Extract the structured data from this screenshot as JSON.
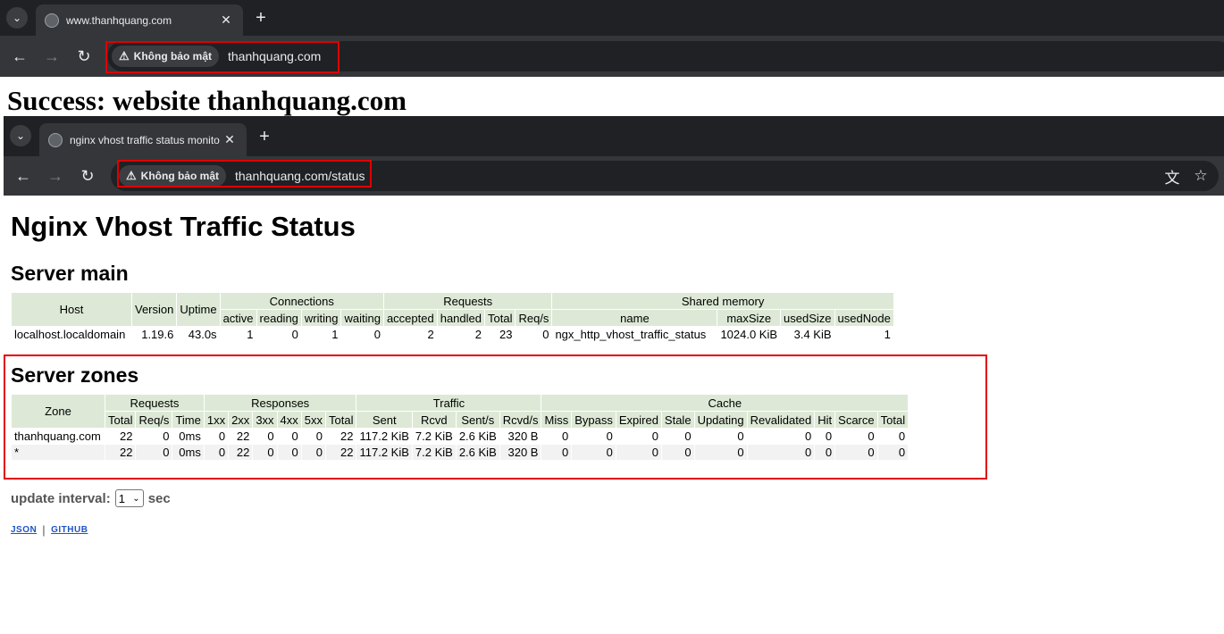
{
  "browser1": {
    "tab_title": "www.thanhquang.com",
    "security_label": "Không bảo mật",
    "url": "thanhquang.com"
  },
  "success_heading": "Success: website thanhquang.com",
  "browser2": {
    "tab_title": "nginx vhost traffic status monito",
    "security_label": "Không bảo mật",
    "url": "thanhquang.com/status"
  },
  "page": {
    "title": "Nginx Vhost Traffic Status",
    "server_main": {
      "heading": "Server main",
      "group_headers": {
        "host": "Host",
        "version": "Version",
        "uptime": "Uptime",
        "connections": "Connections",
        "requests": "Requests",
        "shared_memory": "Shared memory"
      },
      "sub_headers": [
        "active",
        "reading",
        "writing",
        "waiting",
        "accepted",
        "handled",
        "Total",
        "Req/s",
        "name",
        "maxSize",
        "usedSize",
        "usedNode"
      ],
      "row": [
        "localhost.localdomain",
        "1.19.6",
        "43.0s",
        "1",
        "0",
        "1",
        "0",
        "2",
        "2",
        "23",
        "0",
        "ngx_http_vhost_traffic_status",
        "1024.0 KiB",
        "3.4 KiB",
        "1"
      ]
    },
    "server_zones": {
      "heading": "Server zones",
      "group_headers": {
        "zone": "Zone",
        "requests": "Requests",
        "responses": "Responses",
        "traffic": "Traffic",
        "cache": "Cache"
      },
      "sub_headers": [
        "Total",
        "Req/s",
        "Time",
        "1xx",
        "2xx",
        "3xx",
        "4xx",
        "5xx",
        "Total",
        "Sent",
        "Rcvd",
        "Sent/s",
        "Rcvd/s",
        "Miss",
        "Bypass",
        "Expired",
        "Stale",
        "Updating",
        "Revalidated",
        "Hit",
        "Scarce",
        "Total"
      ],
      "rows": [
        [
          "thanhquang.com",
          "22",
          "0",
          "0ms",
          "0",
          "22",
          "0",
          "0",
          "0",
          "22",
          "117.2 KiB",
          "7.2 KiB",
          "2.6 KiB",
          "320 B",
          "0",
          "0",
          "0",
          "0",
          "0",
          "0",
          "0",
          "0",
          "0"
        ],
        [
          "*",
          "22",
          "0",
          "0ms",
          "0",
          "22",
          "0",
          "0",
          "0",
          "22",
          "117.2 KiB",
          "7.2 KiB",
          "2.6 KiB",
          "320 B",
          "0",
          "0",
          "0",
          "0",
          "0",
          "0",
          "0",
          "0",
          "0"
        ]
      ]
    },
    "update_interval": {
      "label": "update interval:",
      "value": "1",
      "unit": "sec"
    },
    "links": {
      "json": "JSON",
      "separator": "|",
      "github": "GITHUB"
    }
  },
  "icons": {
    "tab_menu": "chevron-down-icon",
    "globe": "globe-icon",
    "close": "close-icon",
    "new_tab": "plus-icon",
    "back": "back-arrow-icon",
    "forward": "forward-arrow-icon",
    "reload": "reload-icon",
    "warning": "warning-icon",
    "translate": "translate-icon",
    "bookmark": "star-icon"
  },
  "colors": {
    "highlight_box": "#e00000",
    "table_header_bg": "#dde9d6",
    "link": "#1e54c4"
  }
}
